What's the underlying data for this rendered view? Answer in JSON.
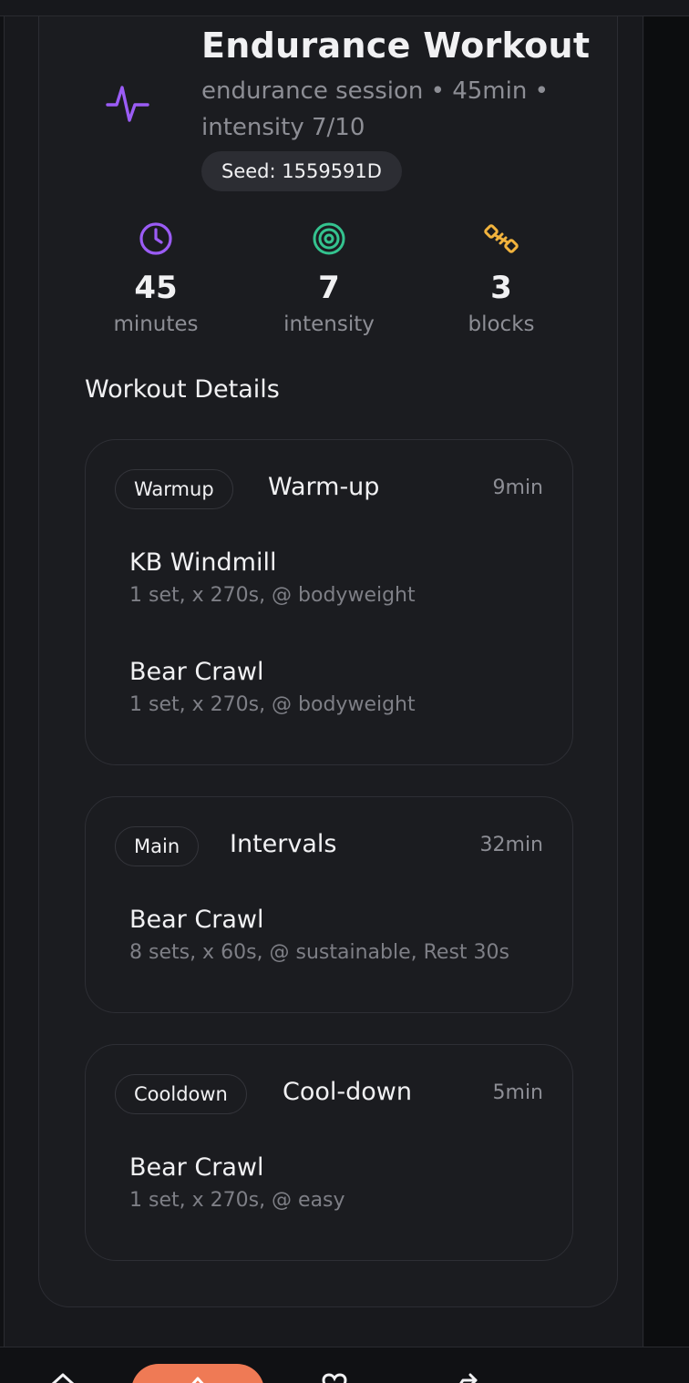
{
  "header": {
    "title": "Endurance Workout",
    "subtitle": "endurance session • 45min • intensity 7/10",
    "seed": "Seed: 1559591D",
    "icon": "activity-pulse-icon",
    "accent_color": "#9b5cf6"
  },
  "stats": [
    {
      "value": "45",
      "label": "minutes",
      "icon": "clock-icon",
      "color": "#9b5cf6"
    },
    {
      "value": "7",
      "label": "intensity",
      "icon": "target-icon",
      "color": "#34c38f"
    },
    {
      "value": "3",
      "label": "blocks",
      "icon": "dumbbell-icon",
      "color": "#f2b33d"
    }
  ],
  "details": {
    "heading": "Workout Details",
    "blocks": [
      {
        "tag": "Warmup",
        "name": "Warm-up",
        "duration": "9min",
        "exercises": [
          {
            "name": "KB Windmill",
            "detail": "1 set, x 270s, @ bodyweight"
          },
          {
            "name": "Bear Crawl",
            "detail": "1 set, x 270s, @ bodyweight"
          }
        ]
      },
      {
        "tag": "Main",
        "name": "Intervals",
        "duration": "32min",
        "exercises": [
          {
            "name": "Bear Crawl",
            "detail": "8 sets, x 60s, @ sustainable, Rest 30s"
          }
        ]
      },
      {
        "tag": "Cooldown",
        "name": "Cool-down",
        "duration": "5min",
        "exercises": [
          {
            "name": "Bear Crawl",
            "detail": "1 set, x 270s, @ easy"
          }
        ]
      }
    ]
  },
  "nav": {
    "items": [
      "home-icon",
      "workout-icon",
      "heart-icon",
      "share-icon"
    ],
    "active_color": "#ef7a55"
  }
}
